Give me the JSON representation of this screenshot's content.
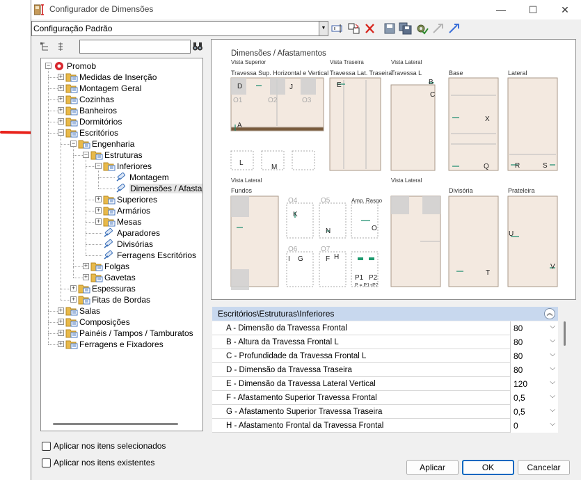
{
  "window": {
    "title": "Configurador de Dimensões",
    "minimize": "—",
    "maximize": "☐",
    "close": "✕"
  },
  "toolbar": {
    "config_value": "Configuração Padrão",
    "icons": [
      "rename-icon",
      "copy-config-icon",
      "delete-icon",
      "save-icon",
      "save-all-icon",
      "settings-check-icon",
      "import-icon",
      "export-icon"
    ]
  },
  "tree": {
    "search_placeholder": "",
    "nodes": [
      {
        "label": "Promob",
        "level": 0,
        "expanded": true,
        "icon": "promob-logo-icon"
      },
      {
        "label": "Medidas de Inserção",
        "level": 1,
        "expanded": false,
        "icon": "folder-icon"
      },
      {
        "label": "Montagem Geral",
        "level": 1,
        "expanded": false,
        "icon": "folder-icon"
      },
      {
        "label": "Cozinhas",
        "level": 1,
        "expanded": false,
        "icon": "folder-icon"
      },
      {
        "label": "Banheiros",
        "level": 1,
        "expanded": false,
        "icon": "folder-icon"
      },
      {
        "label": "Dormitórios",
        "level": 1,
        "expanded": false,
        "icon": "folder-icon"
      },
      {
        "label": "Escritórios",
        "level": 1,
        "expanded": true,
        "icon": "folder-icon"
      },
      {
        "label": "Engenharia",
        "level": 2,
        "expanded": true,
        "icon": "folder-icon"
      },
      {
        "label": "Estruturas",
        "level": 3,
        "expanded": true,
        "icon": "folder-icon"
      },
      {
        "label": "Inferiores",
        "level": 4,
        "expanded": true,
        "icon": "folder-icon"
      },
      {
        "label": "Montagem",
        "level": 5,
        "expanded": null,
        "icon": "item-icon"
      },
      {
        "label": "Dimensões / Afastamentos",
        "level": 5,
        "expanded": null,
        "icon": "item-icon",
        "selected": true
      },
      {
        "label": "Superiores",
        "level": 4,
        "expanded": false,
        "icon": "folder-icon"
      },
      {
        "label": "Armários",
        "level": 4,
        "expanded": false,
        "icon": "folder-icon"
      },
      {
        "label": "Mesas",
        "level": 4,
        "expanded": false,
        "icon": "folder-icon"
      },
      {
        "label": "Aparadores",
        "level": 4,
        "expanded": null,
        "icon": "item-icon"
      },
      {
        "label": "Divisórias",
        "level": 4,
        "expanded": null,
        "icon": "item-icon"
      },
      {
        "label": "Ferragens Escritórios",
        "level": 4,
        "expanded": null,
        "icon": "item-icon"
      },
      {
        "label": "Folgas",
        "level": 3,
        "expanded": false,
        "icon": "folder-icon"
      },
      {
        "label": "Gavetas",
        "level": 3,
        "expanded": false,
        "icon": "folder-icon"
      },
      {
        "label": "Espessuras",
        "level": 2,
        "expanded": false,
        "icon": "folder-icon"
      },
      {
        "label": "Fitas de Bordas",
        "level": 2,
        "expanded": false,
        "icon": "folder-icon"
      },
      {
        "label": "Salas",
        "level": 1,
        "expanded": false,
        "icon": "folder-icon"
      },
      {
        "label": "Composições",
        "level": 1,
        "expanded": false,
        "icon": "folder-icon"
      },
      {
        "label": "Painéis / Tampos / Tamburatos",
        "level": 1,
        "expanded": false,
        "icon": "folder-icon"
      },
      {
        "label": "Ferragens e Fixadores",
        "level": 1,
        "expanded": false,
        "icon": "folder-icon"
      }
    ]
  },
  "options": {
    "apply_selected": "Aplicar nos itens selecionados",
    "apply_existing": "Aplicar nos itens existentes"
  },
  "diagram": {
    "title": "Dimensões / Afastamentos",
    "row1_views": [
      "Vista Superior",
      "Vista Traseira",
      "Vista Lateral"
    ],
    "row1_labels": [
      "Travessa Sup. Horizontal e Vertical",
      "Travessa Lat. Traseira",
      "Travessa L",
      "Base",
      "Lateral"
    ],
    "row2_views": [
      "Vista Lateral",
      "Vista Lateral"
    ],
    "row2_labels": [
      "Fundos",
      "Amp. Rasgo",
      "Divisória",
      "Prateleira"
    ],
    "formula": "P = P1+P2",
    "letters": [
      "A",
      "B",
      "C",
      "D",
      "E",
      "J",
      "L",
      "M",
      "K",
      "N",
      "O",
      "I",
      "G",
      "F",
      "H",
      "P1",
      "P2",
      "Q",
      "R",
      "S",
      "T",
      "U",
      "V",
      "X"
    ],
    "zones": [
      "O1",
      "O2",
      "O3",
      "O4",
      "O5",
      "O6",
      "O7"
    ]
  },
  "properties": {
    "path": "Escritórios\\Estruturas\\Inferiores",
    "rows": [
      {
        "name": "A - Dimensão da Travessa Frontal",
        "value": "80"
      },
      {
        "name": "B - Altura da Travessa Frontal L",
        "value": "80"
      },
      {
        "name": "C - Profundidade da Travessa Frontal L",
        "value": "80"
      },
      {
        "name": "D - Dimensão da Travessa Traseira",
        "value": "80"
      },
      {
        "name": "E - Dimensão da Travessa Lateral Vertical",
        "value": "120"
      },
      {
        "name": "F - Afastamento Superior Travessa Frontal",
        "value": "0,5"
      },
      {
        "name": "G - Afastamento Superior Travessa Traseira",
        "value": "0,5"
      },
      {
        "name": "H - Afastamento Frontal da Travessa Frontal",
        "value": "0"
      }
    ]
  },
  "buttons": {
    "apply": "Aplicar",
    "ok": "OK",
    "cancel": "Cancelar"
  }
}
